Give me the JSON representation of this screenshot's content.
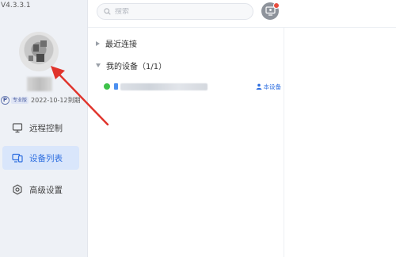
{
  "app": {
    "version": "V4.3.3.1"
  },
  "account": {
    "plan_badge_letter": "P",
    "plan_label": "专业版",
    "expire_text": "2022-10-12到期"
  },
  "nav": {
    "items": [
      {
        "id": "remote",
        "label": "远程控制",
        "icon": "monitor-icon",
        "active": false
      },
      {
        "id": "devices",
        "label": "设备列表",
        "icon": "device-list-icon",
        "active": true
      },
      {
        "id": "advanced",
        "label": "高级设置",
        "icon": "gear-icon",
        "active": false
      }
    ]
  },
  "search": {
    "placeholder": "搜索",
    "value": ""
  },
  "groups": {
    "recent": {
      "label": "最近连接",
      "expanded": false
    },
    "mine": {
      "label": "我的设备（1/1）",
      "expanded": true
    }
  },
  "device": {
    "status": "online",
    "this_device_label": "本设备"
  },
  "colors": {
    "accent": "#2f6fe0",
    "online": "#3ec24a",
    "annotation": "#e0332b",
    "sidebar_bg": "#eef1f6"
  }
}
